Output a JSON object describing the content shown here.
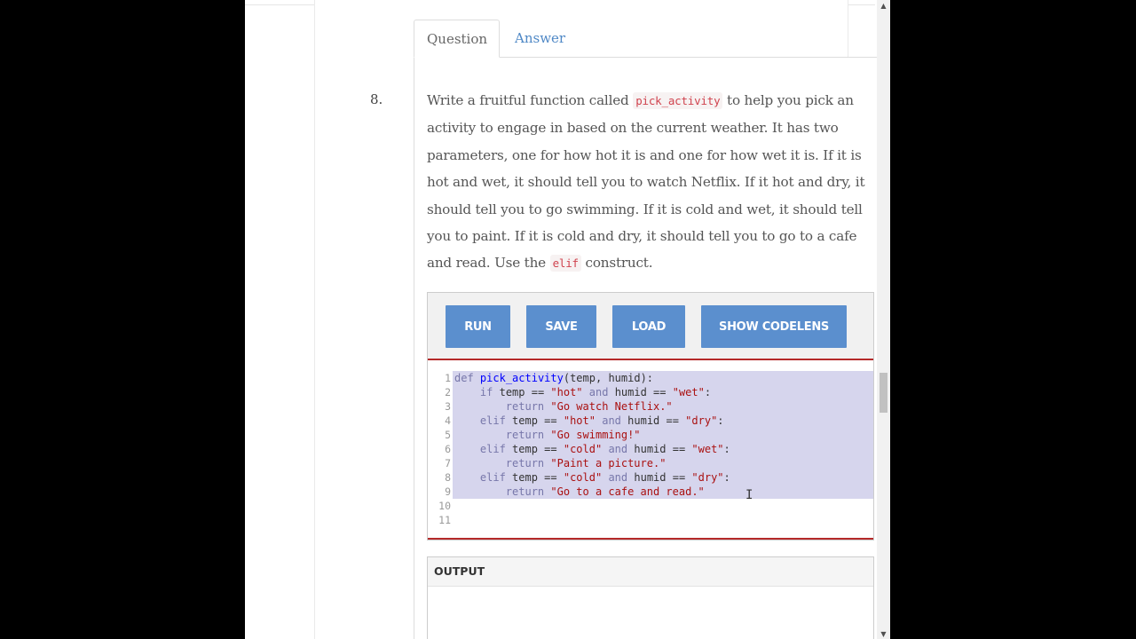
{
  "tabs": [
    {
      "label": "Question",
      "active": true
    },
    {
      "label": "Answer",
      "active": false
    }
  ],
  "question": {
    "number": "8.",
    "text_before_fn": "Write a fruitful function called ",
    "fn_name": "pick_activity",
    "text_after_fn": " to help you pick an activity to engage in based on the current weather. It has two parameters, one for how hot it is and one for how wet it is. If it is hot and wet, it should tell you to watch Netflix. If it hot and dry, it should tell you to go swimming. If it is cold and wet, it should tell you to paint. If it is cold and dry, it should tell you to go to a cafe and read. Use the ",
    "construct": "elif",
    "text_end": " construct."
  },
  "toolbar": {
    "run_label": "RUN",
    "save_label": "SAVE",
    "load_label": "LOAD",
    "codelens_label": "SHOW CODELENS"
  },
  "editor": {
    "lines": [
      {
        "n": "1",
        "code": "def pick_activity(temp, humid):",
        "selected": true
      },
      {
        "n": "2",
        "code": "    if temp == \"hot\" and humid == \"wet\":",
        "selected": true
      },
      {
        "n": "3",
        "code": "        return \"Go watch Netflix.\"",
        "selected": true
      },
      {
        "n": "4",
        "code": "    elif temp == \"hot\" and humid == \"dry\":",
        "selected": true
      },
      {
        "n": "5",
        "code": "        return \"Go swimming!\"",
        "selected": true
      },
      {
        "n": "6",
        "code": "    elif temp == \"cold\" and humid == \"wet\":",
        "selected": true
      },
      {
        "n": "7",
        "code": "        return \"Paint a picture.\"",
        "selected": true
      },
      {
        "n": "8",
        "code": "    elif temp == \"cold\" and humid == \"dry\":",
        "selected": true
      },
      {
        "n": "9",
        "code": "        return \"Go to a cafe and read.\"",
        "selected": true
      },
      {
        "n": "10",
        "code": "",
        "selected": false
      },
      {
        "n": "11",
        "code": "",
        "selected": false
      }
    ]
  },
  "output": {
    "label": "OUTPUT"
  },
  "colors": {
    "button": "#5b8fce",
    "editor_border": "#b52a2a",
    "selection": "#d6d5ed",
    "link": "#4f88c6",
    "inline_code": "#d0434e"
  }
}
